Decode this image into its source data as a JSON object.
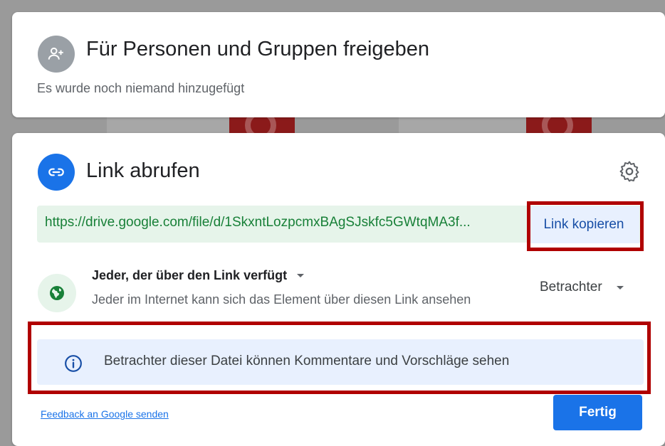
{
  "share_section": {
    "title": "Für Personen und Gruppen freigeben",
    "subtitle": "Es wurde noch niemand hinzugefügt",
    "icon": "person-add-icon"
  },
  "link_section": {
    "title": "Link abrufen",
    "icon": "link-icon",
    "settings_icon": "gear-icon",
    "url": "https://drive.google.com/file/d/1SkxntLozpcmxBAgSJskfc5GWtqMA3f...",
    "copy_label": "Link kopieren"
  },
  "access": {
    "icon": "globe-icon",
    "scope_label": "Jeder, der über den Link verfügt",
    "description": "Jeder im Internet kann sich das Element über diesen Link ansehen",
    "role_label": "Betrachter"
  },
  "info": {
    "icon": "info-icon",
    "text": "Betrachter dieser Datei können Kommentare und Vorschläge sehen"
  },
  "footer": {
    "feedback_label": "Feedback an Google senden",
    "done_label": "Fertig"
  },
  "colors": {
    "accent": "#1a73e8",
    "link_green": "#188038",
    "highlight_red": "#b00000"
  }
}
